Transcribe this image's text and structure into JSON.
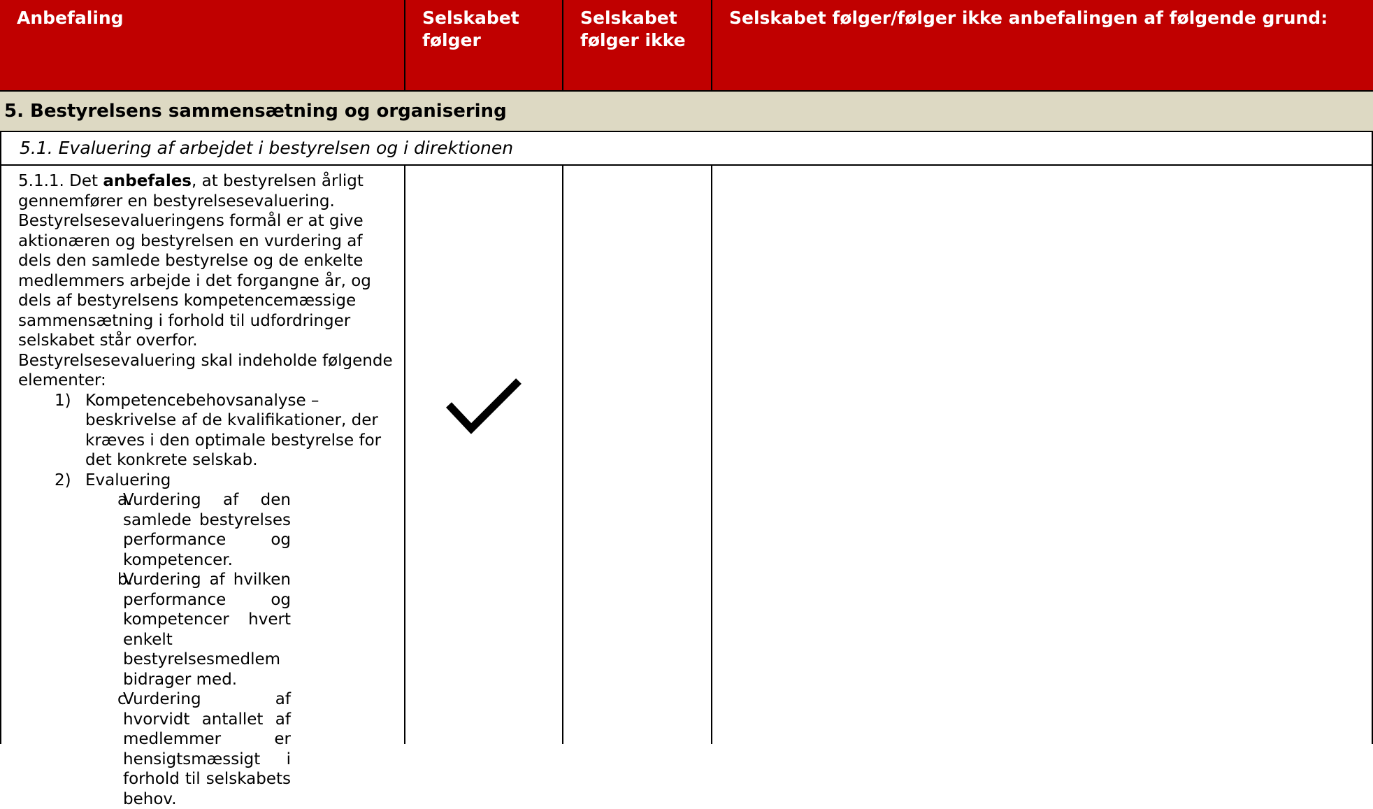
{
  "header": {
    "col1": "Anbefaling",
    "col2": "Selskabet følger",
    "col3": "Selskabet følger ikke",
    "col4": "Selskabet følger/følger ikke anbefalingen af følgende grund:"
  },
  "section": {
    "title": "5. Bestyrelsens sammensætning og organisering"
  },
  "subsection": {
    "title": "5.1. Evaluering af arbejdet i bestyrelsen og i direktionen"
  },
  "recommendation": {
    "prefix": "5.1.1. Det ",
    "bold_word": "anbefales",
    "intro_rest": ", at bestyrelsen årligt gennemfører en bestyrelsesevaluering. Bestyrelsesevalueringens formål er at give aktionæren og bestyrelsen en vurdering af dels den samlede bestyrelse og de enkelte medlemmers arbejde i det forgangne år, og dels af bestyrelsens kompetencemæssige sammensætning i forhold til udfordringer selskabet står overfor.",
    "line2": "Bestyrelsesevaluering skal indeholde følgende elementer:",
    "items": [
      {
        "marker": "1)",
        "text": "Kompetencebehovsanalyse – beskrivelse af de kvalifikationer, der kræves i den optimale bestyrelse for det konkrete selskab."
      },
      {
        "marker": "2)",
        "text": "Evaluering"
      }
    ],
    "subitems": [
      {
        "marker": "a.",
        "text": "Vurdering af den samlede bestyrelses performance og kompetencer."
      },
      {
        "marker": "b.",
        "text": "Vurdering af hvilken performance og kompetencer hvert enkelt bestyrelsesmedlem bidrager med."
      },
      {
        "marker": "c.",
        "text": "Vurdering af hvorvidt antallet af medlemmer er hensigtsmæssigt i forhold til selskabets behov."
      }
    ]
  },
  "status": {
    "follows_icon": "checkmark-icon",
    "explanation": ""
  },
  "colors": {
    "header_bg": "#c00000",
    "section_bg": "#ddd9c3"
  }
}
